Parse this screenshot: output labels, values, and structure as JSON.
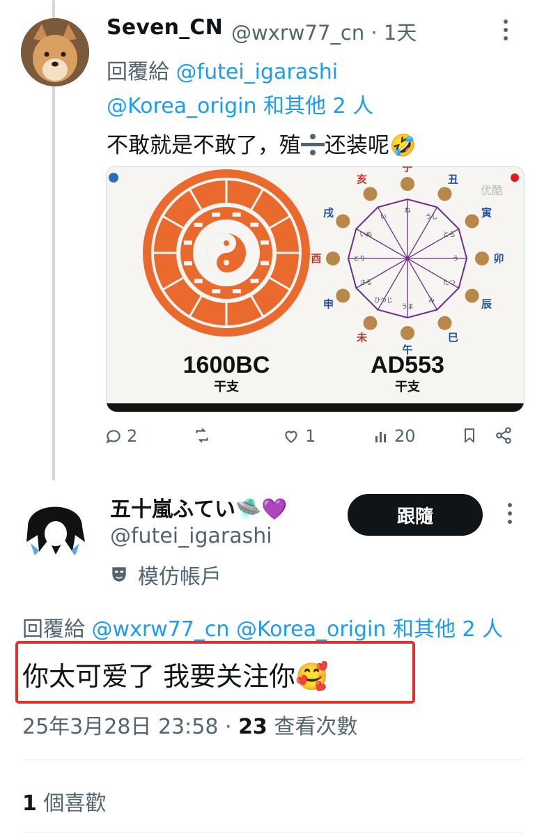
{
  "tweet1": {
    "display_name": "Seven_CN",
    "handle_time": "@wxrw77_cn · 1天",
    "reply_prefix": "回覆給",
    "reply_user1": "@futei_igarashi",
    "reply_user2": "@Korea_origin",
    "reply_others": "和其他 2 人",
    "text": "不敢就是不敢了，殖",
    "text_tail": "还装呢",
    "text_emoji": "🤣",
    "media": {
      "left_label": "1600BC",
      "left_sub": "干支",
      "right_label": "AD553",
      "right_sub": "干支",
      "watermark": "优酷",
      "zodiac_kanji": [
        "子",
        "丑",
        "寅",
        "卯",
        "辰",
        "巳",
        "午",
        "未",
        "申",
        "酉",
        "戌",
        "亥"
      ],
      "zodiac_kana": [
        "ね",
        "うし",
        "とら",
        "う",
        "たつ",
        "み",
        "うま",
        "ひつじ",
        "さる",
        "とり",
        "いぬ",
        "い"
      ]
    },
    "actions": {
      "replies": "2",
      "likes": "1",
      "views": "20"
    }
  },
  "tweet2": {
    "display_name": "五十嵐ふてい",
    "name_emoji": "🛸💜",
    "handle": "@futei_igarashi",
    "follow_label": "跟隨",
    "impersonation_label": "模仿帳戶",
    "reply_prefix": "回覆給",
    "reply_user1": "@wxrw77_cn",
    "reply_user2": "@Korea_origin",
    "reply_others": "和其他 2 人",
    "text": "你太可爱了 我要关注你",
    "text_emoji": "🥰",
    "timestamp": "25年3月28日 23:58",
    "views_count": "23",
    "views_label": "查看次數",
    "likes_count": "1",
    "likes_label": "個喜歡"
  },
  "colors": {
    "link": "#1d9bf0",
    "muted": "#536471",
    "highlight": "#e0322b",
    "follow_bg": "#0f1419"
  }
}
